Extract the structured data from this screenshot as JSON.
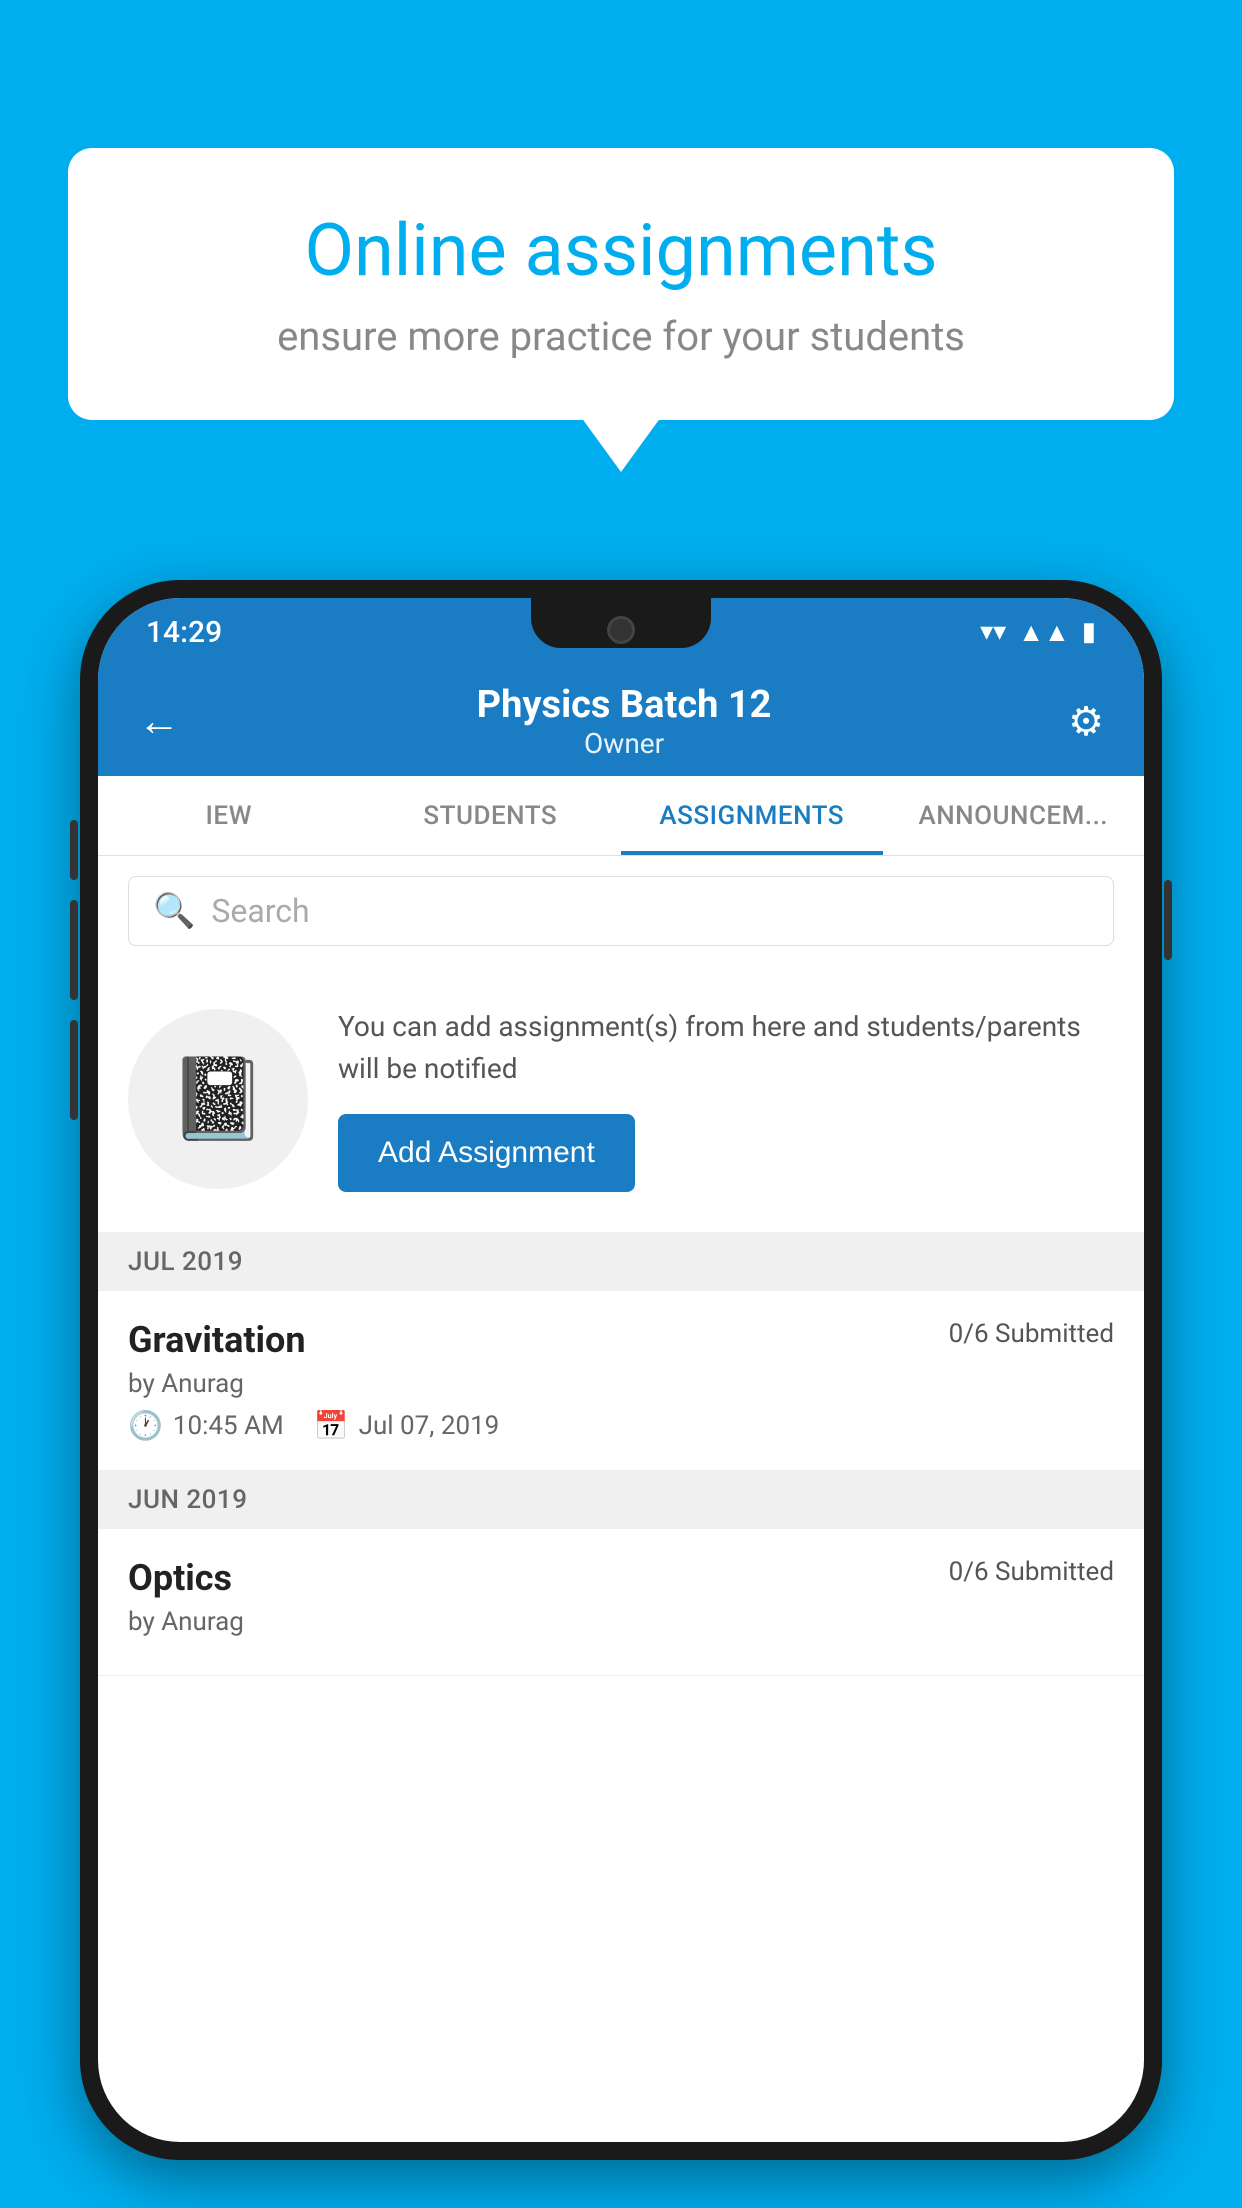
{
  "background_color": "#00AEEF",
  "speech_bubble": {
    "title": "Online assignments",
    "subtitle": "ensure more practice for your students"
  },
  "phone": {
    "status_bar": {
      "time": "14:29",
      "wifi": "▼",
      "signal": "▲",
      "battery": "▮"
    },
    "header": {
      "title": "Physics Batch 12",
      "subtitle": "Owner",
      "back_label": "←",
      "settings_label": "⚙"
    },
    "tabs": [
      {
        "label": "IEW",
        "active": false
      },
      {
        "label": "STUDENTS",
        "active": false
      },
      {
        "label": "ASSIGNMENTS",
        "active": true
      },
      {
        "label": "ANNOUNCEM...",
        "active": false
      }
    ],
    "search": {
      "placeholder": "Search"
    },
    "promo": {
      "text": "You can add assignment(s) from here and students/parents will be notified",
      "button_label": "Add Assignment"
    },
    "sections": [
      {
        "month": "JUL 2019",
        "assignments": [
          {
            "title": "Gravitation",
            "submitted": "0/6 Submitted",
            "author": "by Anurag",
            "time": "10:45 AM",
            "date": "Jul 07, 2019"
          }
        ]
      },
      {
        "month": "JUN 2019",
        "assignments": [
          {
            "title": "Optics",
            "submitted": "0/6 Submitted",
            "author": "by Anurag",
            "time": "",
            "date": ""
          }
        ]
      }
    ]
  }
}
